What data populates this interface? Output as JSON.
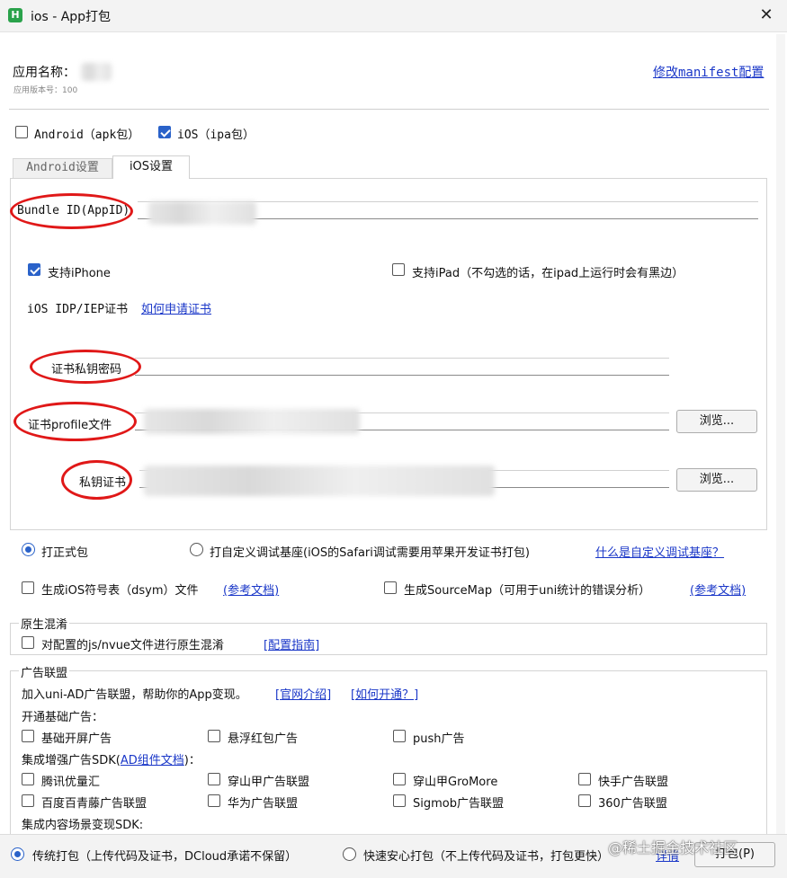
{
  "window": {
    "title": "ios - App打包",
    "app_icon_letter": "H"
  },
  "header": {
    "app_name_label": "应用名称：",
    "app_version_label": "应用版本号：100",
    "manifest_link": "修改manifest配置"
  },
  "platforms": {
    "android": {
      "label": "Android（apk包）",
      "checked": false
    },
    "ios": {
      "label": "iOS（ipa包）",
      "checked": true
    }
  },
  "tabs": [
    {
      "label": "Android设置",
      "active": false
    },
    {
      "label": "iOS设置",
      "active": true
    }
  ],
  "ios_settings": {
    "bundle_id_label": "Bundle ID(AppID)",
    "support_iphone": {
      "label": "支持iPhone",
      "checked": true
    },
    "support_ipad": {
      "label": "支持iPad（不勾选的话，在ipad上运行时会有黑边）",
      "checked": false
    },
    "cert_label": "iOS IDP/IEP证书",
    "cert_link": "如何申请证书",
    "cert_password_label": "证书私钥密码",
    "profile_label": "证书profile文件",
    "private_key_label": "私钥证书",
    "browse_label": "浏览..."
  },
  "package_type": {
    "formal": {
      "label": "打正式包",
      "selected": true
    },
    "custom_base": {
      "label": "打自定义调试基座(iOS的Safari调试需要用苹果开发证书打包)",
      "selected": false
    },
    "custom_base_link": "什么是自定义调试基座？"
  },
  "options": {
    "dsym": {
      "label": "生成iOS符号表（dsym）文件",
      "link": "(参考文档)",
      "checked": false
    },
    "sourcemap": {
      "label": "生成SourceMap（可用于uni统计的错误分析）",
      "link": "(参考文档)",
      "checked": false
    }
  },
  "obfuscation": {
    "title": "原生混淆",
    "label": "对配置的js/nvue文件进行原生混淆",
    "link": "[配置指南]"
  },
  "ads": {
    "title": "广告联盟",
    "intro_text": "加入uni-AD广告联盟，帮助你的App变现。",
    "intro_link1": "[官网介绍]",
    "intro_link2": "[如何开通？]",
    "basic_title": "开通基础广告：",
    "basic": [
      "基础开屏广告",
      "悬浮红包广告",
      "push广告"
    ],
    "enhanced_title_prefix": "集成增强广告SDK(",
    "enhanced_title_link": "AD组件文档",
    "enhanced_title_suffix": ")：",
    "enhanced_row1": [
      "腾讯优量汇",
      "穿山甲广告联盟",
      "穿山甲GroMore",
      "快手广告联盟"
    ],
    "enhanced_row2": [
      "百度百青藤广告联盟",
      "华为广告联盟",
      "Sigmob广告联盟",
      "360广告联盟"
    ],
    "content_title": "集成内容场景变现SDK:"
  },
  "footer": {
    "traditional": {
      "label": "传统打包（上传代码及证书，DCloud承诺不保留）",
      "selected": true
    },
    "safe": {
      "label": "快速安心打包（不上传代码及证书，打包更快）",
      "selected": false
    },
    "details_link": "详情",
    "pack_button": "打包(P)"
  },
  "watermark": "@稀土掘金技术社区"
}
